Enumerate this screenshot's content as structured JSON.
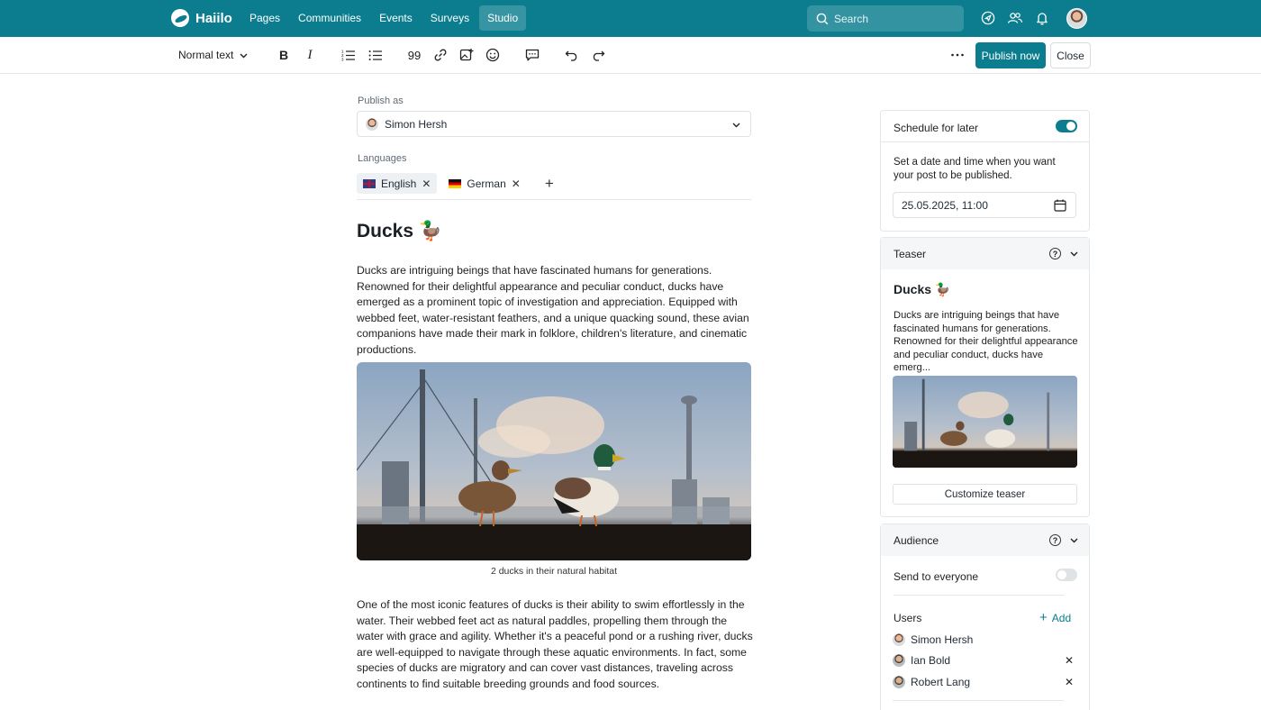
{
  "app": {
    "brand": "Haiilo",
    "accent": "#0b7d8f"
  },
  "nav": {
    "items": [
      "Pages",
      "Communities",
      "Events",
      "Surveys",
      "Studio"
    ],
    "active": "Studio"
  },
  "search": {
    "placeholder": "Search"
  },
  "toolbar": {
    "text_style": "Normal text",
    "buttons": [
      "bold-icon",
      "italic-icon",
      "numbered-list-icon",
      "bullet-list-icon",
      "quote-icon",
      "link-icon",
      "image-icon",
      "emoji-icon",
      "comment-icon",
      "undo-icon",
      "redo-icon",
      "more-icon"
    ],
    "quote_label": "99",
    "publish_label": "Publish now",
    "close_label": "Close"
  },
  "editor": {
    "publish_as_label": "Publish as",
    "publish_as_value": "Simon Hersh",
    "languages_label": "Languages",
    "languages": [
      {
        "name": "English",
        "flag": "uk",
        "active": true
      },
      {
        "name": "German",
        "flag": "de",
        "active": false
      }
    ],
    "title": "Ducks 🦆",
    "paragraph1": "Ducks are intriguing beings that have fascinated humans for generations. Renowned for their delightful appearance and peculiar conduct, ducks have emerged as a prominent topic of investigation and appreciation. Equipped with webbed feet, water-resistant feathers, and a unique quacking sound, these avian companions have made their mark in folklore, children's literature, and cinematic productions.",
    "image_caption": "2 ducks in their natural habitat",
    "paragraph2": "One of the most iconic features of ducks is their ability to swim effortlessly in the water. Their webbed feet act as natural paddles, propelling them through the water with grace and agility. Whether it's a peaceful pond or a rushing river, ducks are well-equipped to navigate through these aquatic environments. In fact, some species of ducks are migratory and can cover vast distances, traveling across continents to find suitable breeding grounds and food sources."
  },
  "schedule": {
    "label": "Schedule for later",
    "enabled": true,
    "help_text": "Set a date and time when you want your post to be published.",
    "date_value": "25.05.2025, 11:00"
  },
  "teaser": {
    "label": "Teaser",
    "title": "Ducks 🦆",
    "excerpt": "Ducks are intriguing beings that have fascinated humans for generations. Renowned for their delightful appearance and peculiar conduct, ducks have emerg...",
    "customize_label": "Customize teaser"
  },
  "audience": {
    "label": "Audience",
    "send_everyone_label": "Send to everyone",
    "send_everyone": false,
    "users_label": "Users",
    "add_label": "Add",
    "users": [
      {
        "name": "Simon Hersh",
        "removable": false
      },
      {
        "name": "Ian Bold",
        "removable": true
      },
      {
        "name": "Robert Lang",
        "removable": true
      }
    ]
  }
}
